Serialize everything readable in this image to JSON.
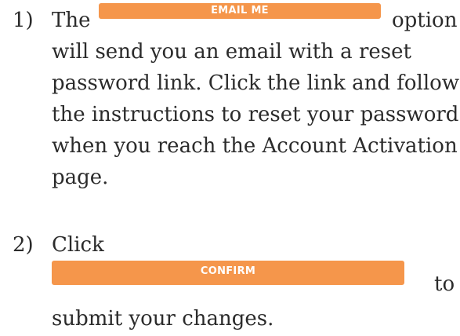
{
  "steps": [
    {
      "number": "1)",
      "before_button": "The",
      "button_label": "EMAIL ME",
      "after_button": "option",
      "lines": [
        "will send you an email with a reset",
        "password link.  Click the link and follow",
        "the instructions to reset your password",
        "when you reach the Account Activation",
        "page."
      ]
    },
    {
      "number": "2)",
      "first_line": "Click",
      "button_label": "CONFIRM",
      "after_button": "to",
      "last_line": "submit your changes."
    }
  ],
  "colors": {
    "button_bg": "#f5964b",
    "button_text": "#ffffff",
    "body_text": "#2b2b2b"
  }
}
